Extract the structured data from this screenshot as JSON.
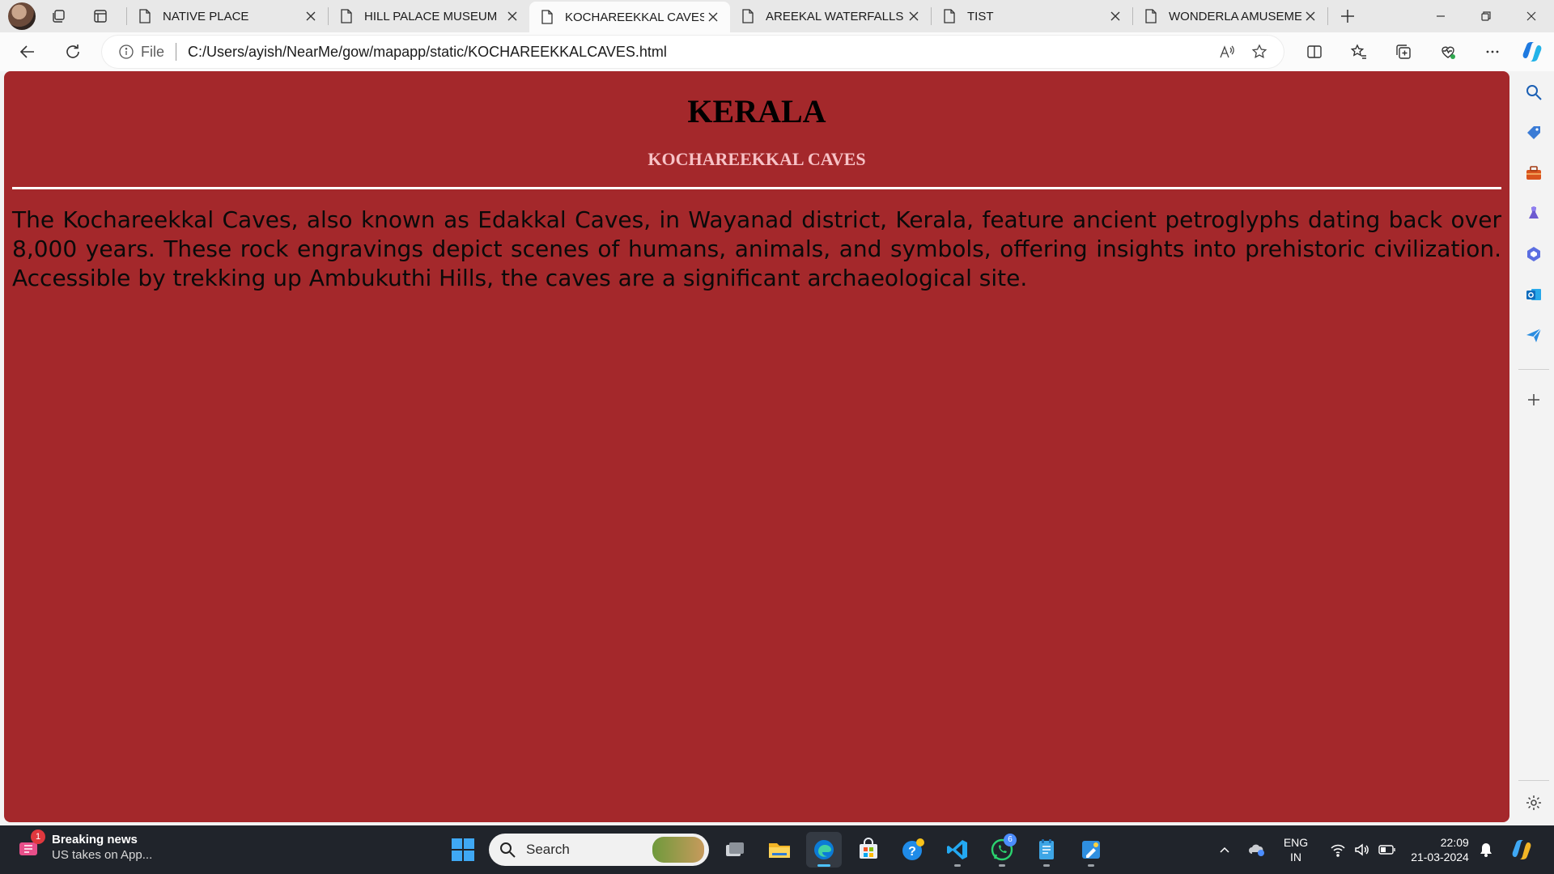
{
  "browser": {
    "tabs": [
      {
        "title": "NATIVE PLACE",
        "active": false
      },
      {
        "title": "HILL PALACE MUSEUM",
        "active": false
      },
      {
        "title": "KOCHAREEKKAL CAVES",
        "active": true
      },
      {
        "title": "AREEKAL WATERFALLS",
        "active": false
      },
      {
        "title": "TIST",
        "active": false
      },
      {
        "title": "WONDERLA AMUSEMEN",
        "active": false
      }
    ],
    "address": {
      "scheme_label": "File",
      "url": "C:/Users/ayish/NearMe/gow/mapapp/static/KOCHAREEKKALCAVES.html"
    }
  },
  "page": {
    "title": "KERALA",
    "subtitle": "KOCHAREEKKAL CAVES",
    "paragraph": "The Kochareekkal Caves, also known as Edakkal Caves, in Wayanad district, Kerala, feature ancient petroglyphs dating back over 8,000 years. These rock engravings depict scenes of humans, animals, and symbols, offering insights into prehistoric civilization. Accessible by trekking up Ambukuthi Hills, the caves are a significant archaeological site.",
    "colors": {
      "background": "#a4282b",
      "title": "#000000",
      "subtitle": "#f7c2c6",
      "rule": "#ffffff"
    }
  },
  "sidebar": {
    "icons": [
      "search-icon",
      "shopping-tag-icon",
      "toolbox-icon",
      "games-icon",
      "microsoft-365-icon",
      "outlook-icon",
      "send-icon",
      "add-icon",
      "settings-icon"
    ]
  },
  "taskbar": {
    "news": {
      "badge": "1",
      "title": "Breaking news",
      "subtitle": "US takes on App..."
    },
    "search_placeholder": "Search",
    "apps": [
      "start-icon",
      "task-view-icon",
      "file-explorer-icon",
      "edge-icon",
      "store-icon",
      "help-icon",
      "vscode-icon",
      "whatsapp-icon",
      "notepad-icon",
      "paint-icon"
    ],
    "whatsapp_badge": "6",
    "language": {
      "line1": "ENG",
      "line2": "IN"
    },
    "clock": {
      "time": "22:09",
      "date": "21-03-2024"
    }
  }
}
